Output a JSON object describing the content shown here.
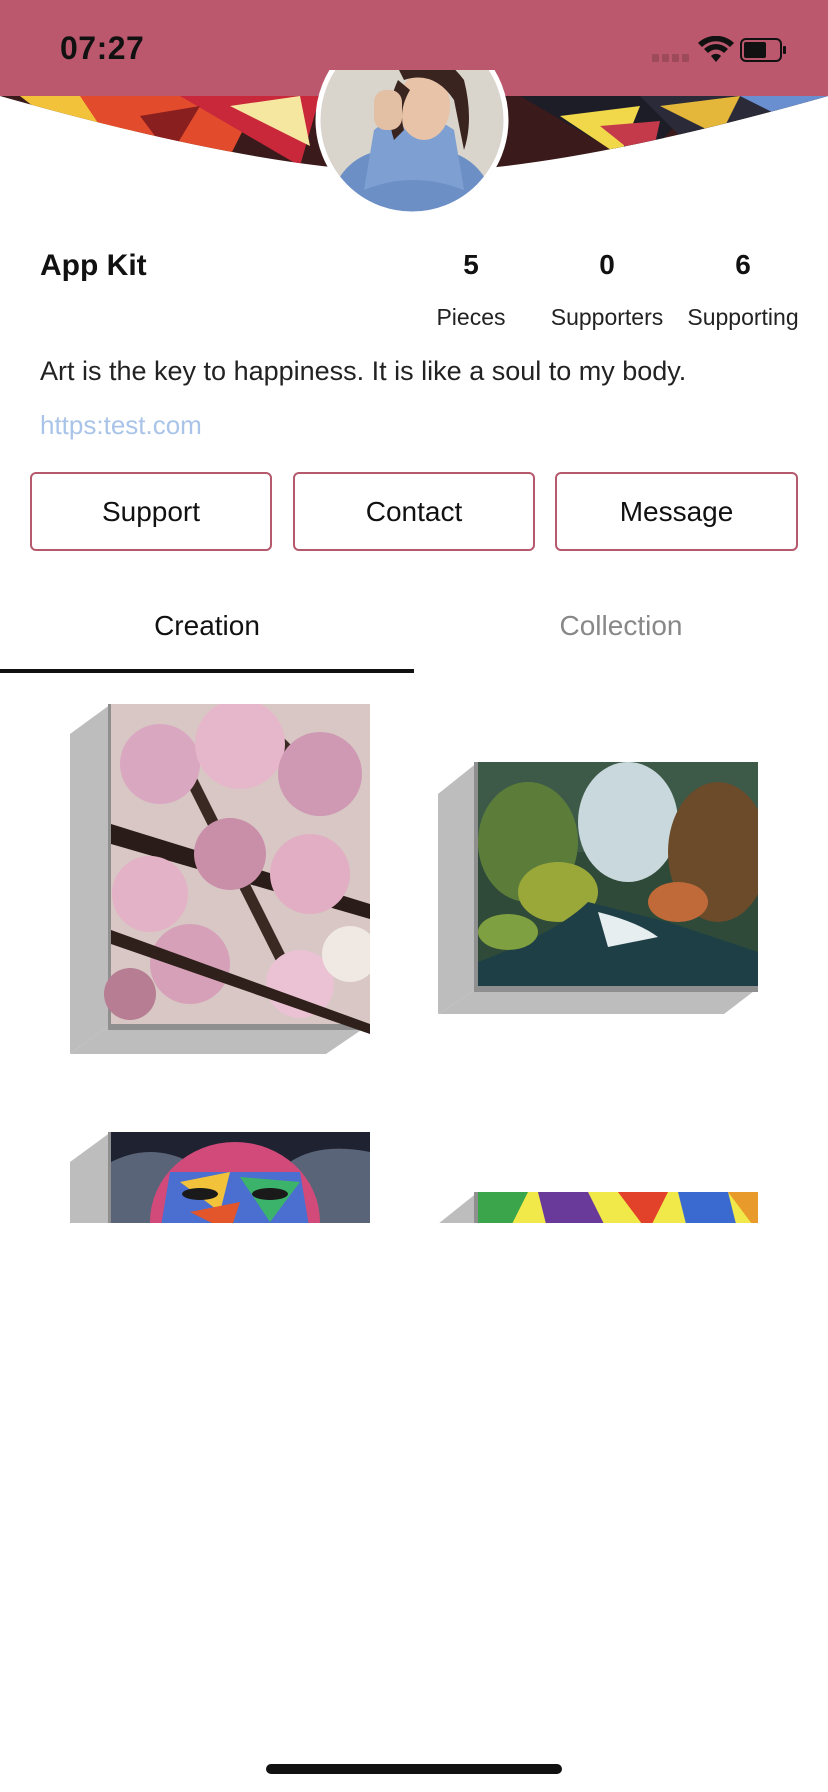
{
  "status": {
    "time": "07:27"
  },
  "profile": {
    "name": "App Kit",
    "bio": "Art is the key to happiness. It is like a soul to my body.",
    "link": "https:test.com",
    "stats": [
      {
        "value": "5",
        "label": "Pieces"
      },
      {
        "value": "0",
        "label": "Supporters"
      },
      {
        "value": "6",
        "label": "Supporting"
      }
    ]
  },
  "actions": {
    "support": "Support",
    "contact": "Contact",
    "message": "Message"
  },
  "tabs": {
    "creation": "Creation",
    "collection": "Collection",
    "active": "creation"
  },
  "colors": {
    "accent": "#bb586d",
    "button_border": "#b5596d",
    "link": "#a9c4e8"
  },
  "icons": [
    "signal-icon",
    "wifi-icon",
    "battery-icon"
  ]
}
